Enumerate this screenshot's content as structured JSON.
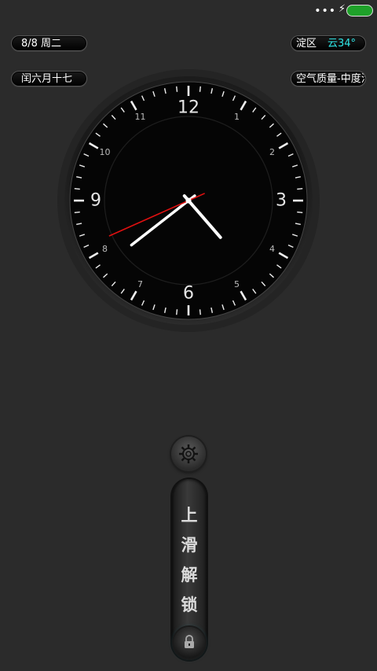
{
  "status_bar": {
    "dots": "•••",
    "charging_icon": "bolt-icon",
    "battery_icon": "battery-icon",
    "battery_color": "#1fa12a"
  },
  "widgets": {
    "date": "8/8 周二",
    "lunar": "闰六月十七",
    "weather_district": "淀区",
    "weather_temp": "云34°",
    "air_quality": "空气质量-中度污"
  },
  "clock": {
    "numerals": [
      "12",
      "1",
      "2",
      "3",
      "4",
      "5",
      "6",
      "7",
      "8",
      "9",
      "10",
      "11"
    ],
    "time": {
      "hour": 4,
      "minute": 38,
      "second": 41
    },
    "second_hand_color": "#e01010"
  },
  "controls": {
    "settings_icon": "gear-icon",
    "unlock_chars": [
      "上",
      "滑",
      "解",
      "锁"
    ],
    "lock_icon": "lock-icon"
  }
}
